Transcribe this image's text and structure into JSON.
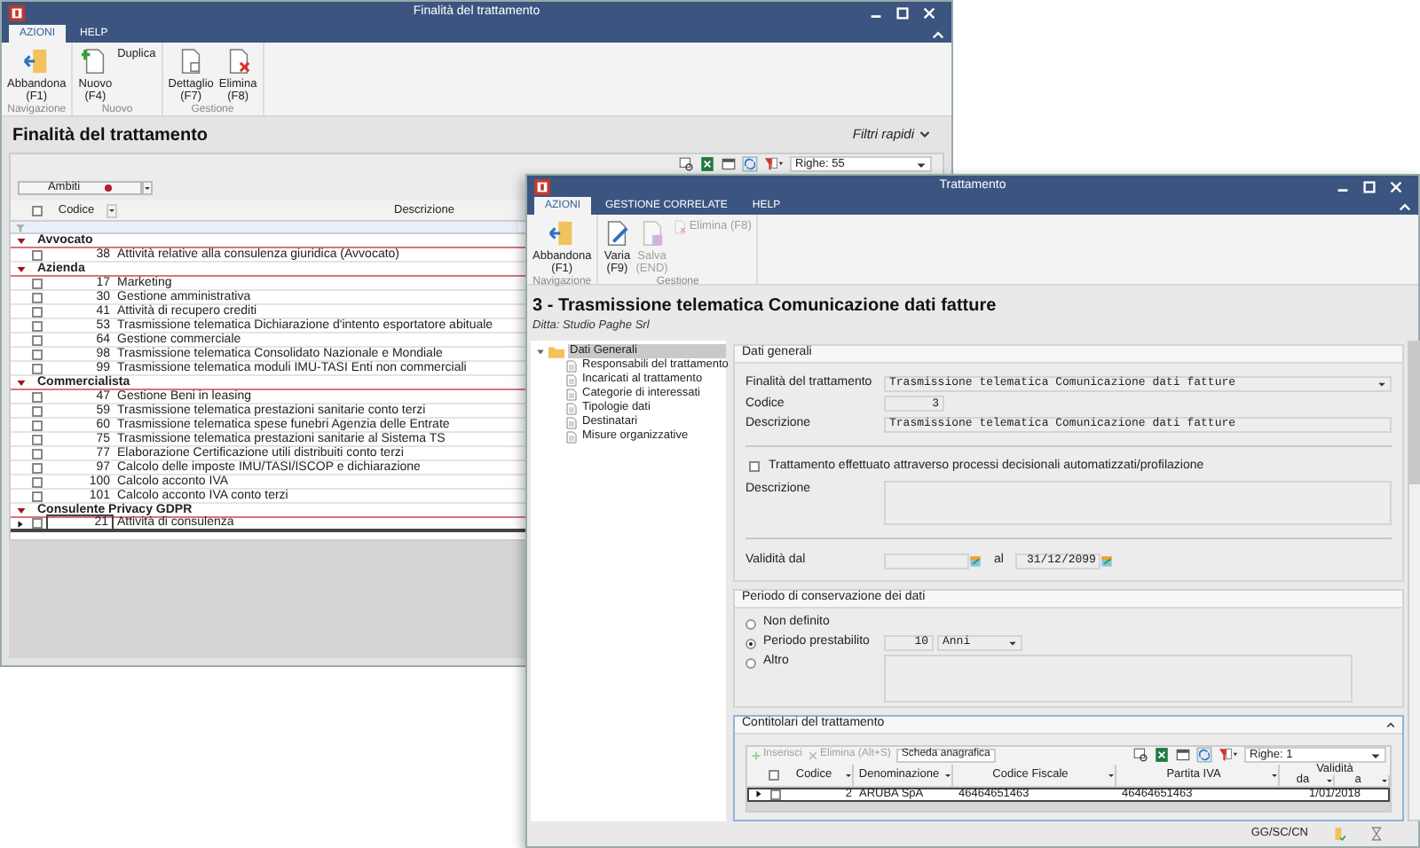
{
  "back_window": {
    "title": "Finalità del trattamento",
    "tabs": [
      {
        "label": "AZIONI",
        "selected": true
      },
      {
        "label": "HELP",
        "selected": false
      }
    ],
    "ribbon": [
      {
        "label": "Navigazione",
        "buttons": [
          {
            "label": "Abbandona",
            "hotkey": "(F1)",
            "kind": "large",
            "disabled": false
          }
        ]
      },
      {
        "label": "Nuovo",
        "buttons": [
          {
            "label": "Nuovo",
            "hotkey": "(F4)",
            "kind": "large",
            "disabled": false
          },
          {
            "label": "Duplica",
            "kind": "small",
            "disabled": false
          }
        ]
      },
      {
        "label": "Gestione",
        "buttons": [
          {
            "label": "Dettaglio",
            "hotkey": "(F7)",
            "kind": "large",
            "disabled": false
          },
          {
            "label": "Elimina",
            "hotkey": "(F8)",
            "kind": "large",
            "disabled": false
          }
        ]
      }
    ],
    "heading": "Finalità del trattamento",
    "quick_filters": "Filtri rapidi",
    "rows_select": "Righe: 55",
    "group_by": "Ambiti",
    "columns": [
      "Codice",
      "Descrizione"
    ],
    "select_all": false,
    "groups": [
      {
        "name": "Avvocato",
        "rows": [
          {
            "code": "38",
            "description": "Attività relative alla consulenza giuridica (Avvocato)",
            "checked": false,
            "current": false
          }
        ]
      },
      {
        "name": "Azienda",
        "rows": [
          {
            "code": "17",
            "description": "Marketing",
            "checked": false,
            "current": false
          },
          {
            "code": "30",
            "description": "Gestione amministrativa",
            "checked": false,
            "current": false
          },
          {
            "code": "41",
            "description": "Attività di recupero crediti",
            "checked": false,
            "current": false
          },
          {
            "code": "53",
            "description": "Trasmissione telematica Dichiarazione d'intento esportatore abituale",
            "checked": false,
            "current": false
          },
          {
            "code": "64",
            "description": "Gestione commerciale",
            "checked": false,
            "current": false
          },
          {
            "code": "98",
            "description": "Trasmissione telematica Consolidato Nazionale e Mondiale",
            "checked": false,
            "current": false
          },
          {
            "code": "99",
            "description": "Trasmissione telematica moduli IMU-TASI Enti non commerciali",
            "checked": false,
            "current": false
          }
        ]
      },
      {
        "name": "Commercialista",
        "rows": [
          {
            "code": "47",
            "description": "Gestione Beni in leasing",
            "checked": false,
            "current": false
          },
          {
            "code": "59",
            "description": "Trasmissione telematica prestazioni sanitarie conto terzi",
            "checked": false,
            "current": false
          },
          {
            "code": "60",
            "description": "Trasmissione telematica spese funebri Agenzia delle Entrate",
            "checked": false,
            "current": false
          },
          {
            "code": "75",
            "description": "Trasmissione telematica prestazioni sanitarie al Sistema TS",
            "checked": false,
            "current": false
          },
          {
            "code": "77",
            "description": "Elaborazione Certificazione utili distribuiti conto terzi",
            "checked": false,
            "current": false
          },
          {
            "code": "97",
            "description": "Calcolo delle imposte IMU/TASI/ISCOP e dichiarazione",
            "checked": false,
            "current": false
          },
          {
            "code": "100",
            "description": "Calcolo acconto IVA",
            "checked": false,
            "current": false
          },
          {
            "code": "101",
            "description": "Calcolo acconto IVA conto terzi",
            "checked": false,
            "current": false
          }
        ]
      },
      {
        "name": "Consulente Privacy GDPR",
        "rows": [
          {
            "code": "21",
            "description": "Attività di consulenza",
            "checked": false,
            "current": true
          }
        ]
      }
    ]
  },
  "front_window": {
    "title": "Trattamento",
    "tabs": [
      {
        "label": "AZIONI",
        "selected": true
      },
      {
        "label": "GESTIONE CORRELATE",
        "selected": false
      },
      {
        "label": "HELP",
        "selected": false
      }
    ],
    "ribbon": [
      {
        "label": "Navigazione",
        "buttons": [
          {
            "label": "Abbandona",
            "hotkey": "(F1)",
            "kind": "large",
            "disabled": false
          }
        ]
      },
      {
        "label": "Gestione",
        "buttons": [
          {
            "label": "Varia",
            "hotkey": "(F9)",
            "kind": "large",
            "disabled": false
          },
          {
            "label": "Salva",
            "hotkey": "(END)",
            "kind": "large",
            "disabled": true
          },
          {
            "label": "Elimina (F8)",
            "kind": "small",
            "disabled": true
          }
        ]
      }
    ],
    "heading": "3 - Trasmissione telematica Comunicazione dati fatture",
    "subheading": "Ditta: Studio Paghe Srl",
    "tree": [
      {
        "label": "Dati Generali",
        "selected": true,
        "expanded": true,
        "children": [
          {
            "label": "Responsabili del trattamento",
            "selected": false
          },
          {
            "label": "Incaricati al trattamento",
            "selected": false
          },
          {
            "label": "Categorie di interessati",
            "selected": false
          },
          {
            "label": "Tipologie dati",
            "selected": false
          },
          {
            "label": "Destinatari",
            "selected": false
          },
          {
            "label": "Misure organizzative",
            "selected": false
          }
        ]
      }
    ],
    "general": {
      "title": "Dati generali",
      "purpose": {
        "label": "Finalità del trattamento",
        "value": "Trasmissione telematica Comunicazione dati fatture"
      },
      "code": {
        "label": "Codice",
        "value": "3"
      },
      "description": {
        "label": "Descrizione",
        "value": "Trasmissione telematica Comunicazione dati fatture"
      },
      "automated": {
        "label": "Trattamento effettuato attraverso processi decisionali automatizzati/profilazione",
        "checked": false
      },
      "automated_description": {
        "label": "Descrizione"
      },
      "valid_from": {
        "label": "Validità dal"
      },
      "valid_to": {
        "label": "al",
        "value": "31/12/2099"
      }
    },
    "retention": {
      "title": "Periodo di conservazione dei dati",
      "amount": "10",
      "unit": "Anni",
      "options": [
        {
          "label": "Non definito",
          "selected": false
        },
        {
          "label": "Periodo prestabilito",
          "selected": true
        },
        {
          "label": "Altro",
          "selected": false
        }
      ]
    },
    "joint": {
      "title": "Contitolari del trattamento",
      "toolbar": [
        {
          "label": "Inserisci",
          "disabled": true
        },
        {
          "label": "Elimina (Alt+S)",
          "disabled": true
        },
        {
          "label": "Scheda anagrafica",
          "disabled": false
        }
      ],
      "rows_select": "Righe: 1",
      "columns": [
        "Codice",
        "Denominazione",
        "Codice Fiscale",
        "Partita IVA"
      ],
      "select_all": false,
      "validity": "Validità",
      "validity_columns": [
        "da",
        "a"
      ],
      "rows": [
        {
          "code": "2",
          "name": "ARUBA SpA",
          "tax_code": "46464651463",
          "vat": "46464651463",
          "from": "1/01/2018",
          "checked": false,
          "current": true
        }
      ]
    },
    "status": "GG/SC/CN"
  }
}
